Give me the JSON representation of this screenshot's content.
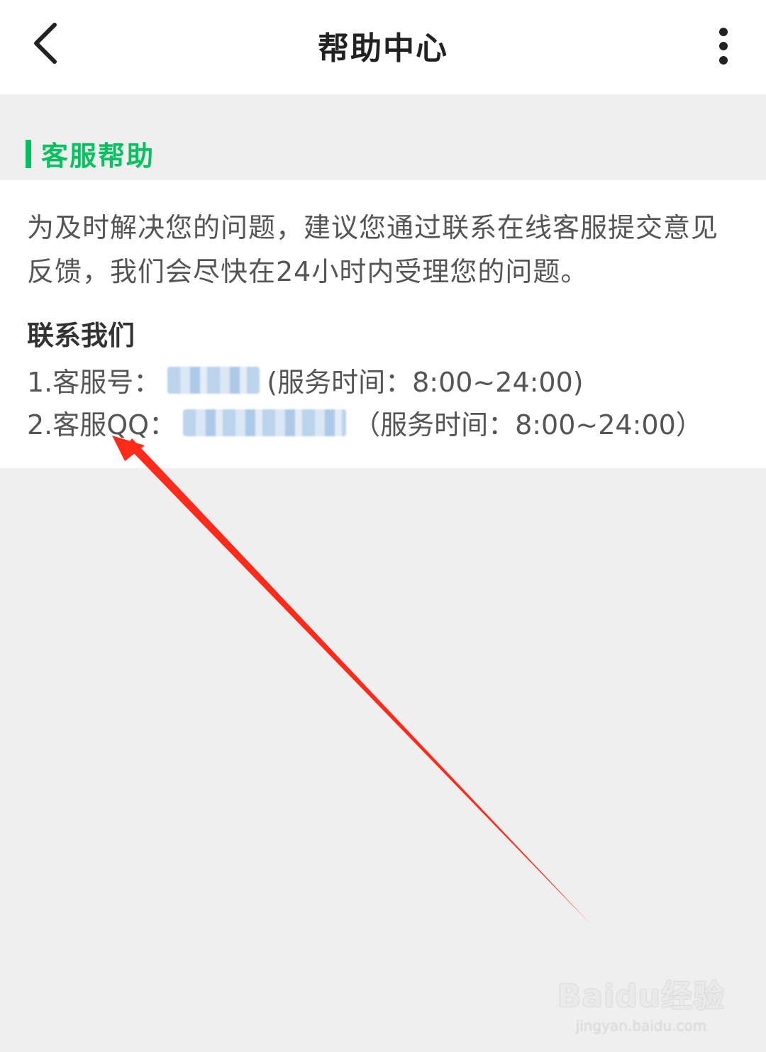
{
  "navbar": {
    "title": "帮助中心",
    "back_icon": "chevron-left-icon",
    "more_icon": "more-vertical-icon"
  },
  "section": {
    "title": "客服帮助",
    "accent_color": "#07c160"
  },
  "card": {
    "intro": "为及时解决您的问题，建议您通过联系在线客服提交意见反馈，我们会尽快在24小时内受理您的问题。",
    "contact_heading": "联系我们",
    "line1_prefix": "1.客服号：",
    "line1_suffix": "(服务时间：8:00~24:00)",
    "line2_prefix": "2.客服QQ：",
    "line2_suffix": "（服务时间：8:00~24:00）"
  },
  "annotation": {
    "arrow_color": "#ff2a1a"
  },
  "watermark": {
    "logo": "Baidu经验",
    "url": "jingyan.baidu.com"
  }
}
